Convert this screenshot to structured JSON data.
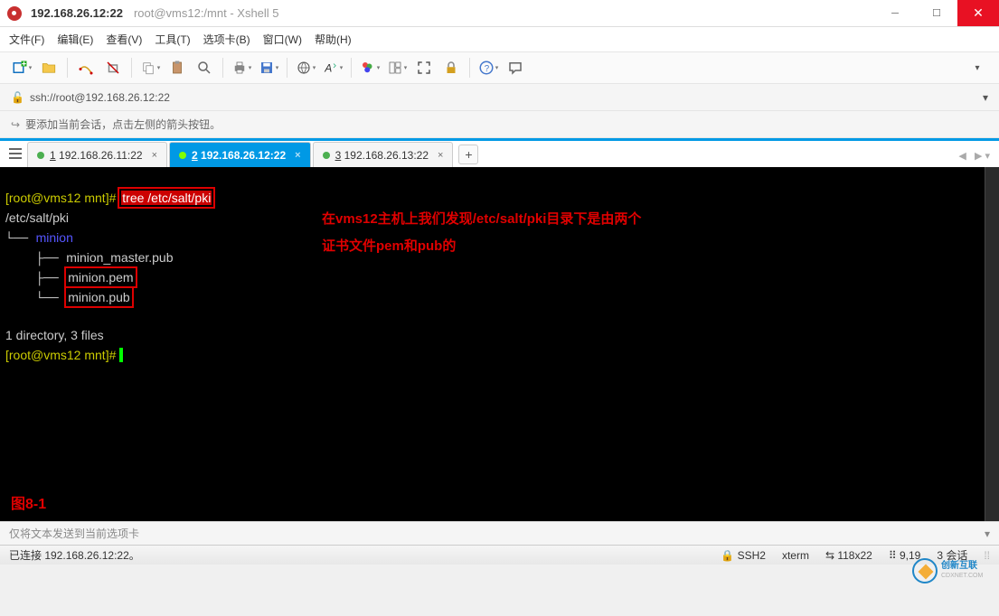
{
  "title": {
    "main": "192.168.26.12:22",
    "sub": "root@vms12:/mnt - Xshell 5"
  },
  "menu": {
    "file": "文件(F)",
    "edit": "编辑(E)",
    "view": "查看(V)",
    "tools": "工具(T)",
    "tabs": "选项卡(B)",
    "window": "窗口(W)",
    "help": "帮助(H)"
  },
  "address": "ssh://root@192.168.26.12:22",
  "tip": "要添加当前会话，点击左侧的箭头按钮。",
  "tabs": [
    {
      "n": "1",
      "label": "192.168.26.11:22",
      "active": false
    },
    {
      "n": "2",
      "label": "192.168.26.12:22",
      "active": true
    },
    {
      "n": "3",
      "label": "192.168.26.13:22",
      "active": false
    }
  ],
  "term": {
    "prompt1_a": "[root@vms12 mnt]# ",
    "cmd": "tree /etc/salt/pki",
    "path": "/etc/salt/pki",
    "dir": "minion",
    "f1": "minion_master.pub",
    "f2": "minion.pem",
    "f3": "minion.pub",
    "summary": "1 directory, 3 files",
    "prompt2": "[root@vms12 mnt]# "
  },
  "ann": {
    "l1": "在vms12主机上我们发现/etc/salt/pki目录下是由两个",
    "l2": "证书文件pem和pub的",
    "fig": "图8-1"
  },
  "sendbar": "仅将文本发送到当前选项卡",
  "status": {
    "conn": "已连接 192.168.26.12:22。",
    "ssh": "SSH2",
    "term": "xterm",
    "size": "118x22",
    "pos": "9,19",
    "sess": "3 会话"
  }
}
